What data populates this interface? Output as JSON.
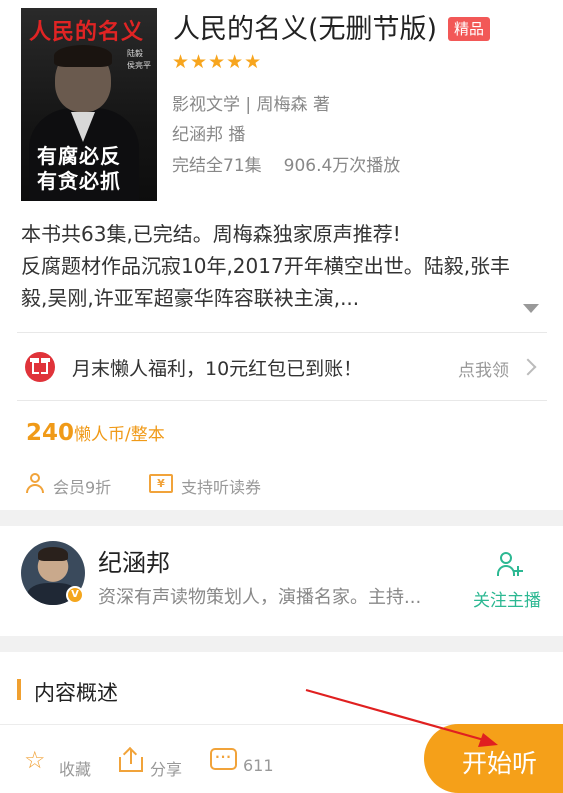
{
  "book": {
    "cover": {
      "title": "人民的名义",
      "slogan_line1": "有腐必反",
      "slogan_line2": "有贪必抓",
      "actor_name": "陆毅",
      "role_name": "侯亮平"
    },
    "title": "人民的名义(无删节版)",
    "badge": "精品",
    "stars": "★★★★★",
    "category_author": "影视文学 | 周梅森 著",
    "narrator": "纪涵邦 播",
    "status": "完结全71集",
    "plays": "906.4万次播放"
  },
  "description": {
    "text": "本书共63集,已完结。周梅森独家原声推荐!\n反腐题材作品沉寂10年,2017开年横空出世。陆毅,张丰毅,吴刚,许亚军超豪华阵容联袂主演,..."
  },
  "promo": {
    "text": "月末懒人福利，10元红包已到账！",
    "cta": "点我领"
  },
  "price": {
    "amount": "240",
    "unit": "懒人币/整本"
  },
  "perks": {
    "member": "会员9折",
    "voucher": "支持听读券",
    "voucher_icon_glyph": "¥"
  },
  "anchor": {
    "name": "纪涵邦",
    "bio": "资深有声读物策划人，演播名家。主持...",
    "verified_glyph": "V",
    "follow_label": "关注主播"
  },
  "section": {
    "title": "内容概述"
  },
  "bottom_bar": {
    "favorite_label": "收藏",
    "share_label": "分享",
    "comment_count": "611",
    "comment_icon_glyph": "···",
    "play_label": "开始听"
  },
  "colors": {
    "accent": "#f5a019",
    "badge_red": "#f25857",
    "follow_green": "#2cb892",
    "annotation_arrow": "#e02020"
  },
  "icons": [
    "gift-icon",
    "chevron-right-icon",
    "user-icon",
    "ticket-icon",
    "follow-user-icon",
    "star-icon",
    "share-icon",
    "comment-icon",
    "expand-arrow-icon"
  ]
}
